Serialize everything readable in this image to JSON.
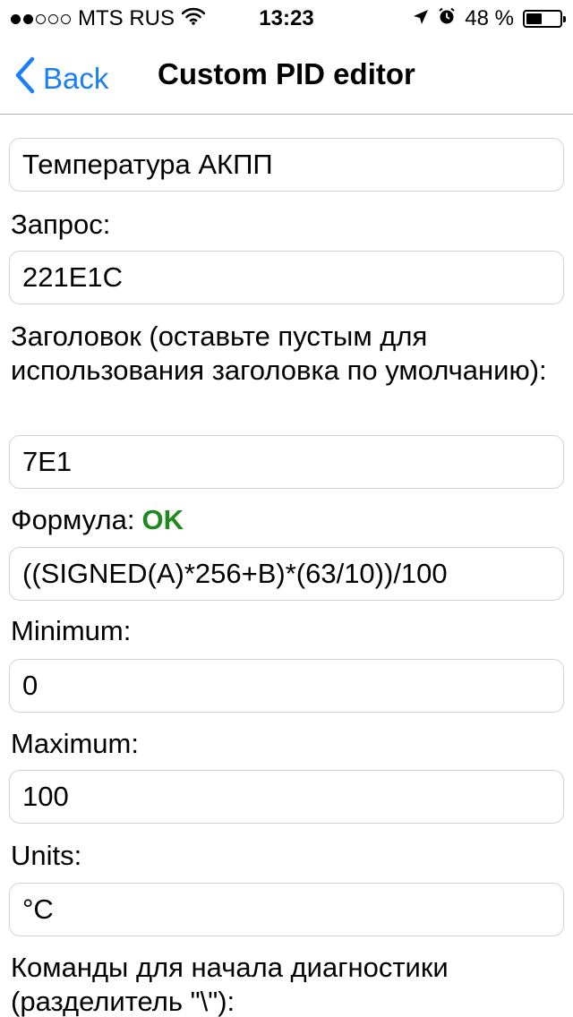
{
  "status_bar": {
    "carrier": "MTS RUS",
    "time": "13:23",
    "battery": "48 %",
    "battery_level": 0.48
  },
  "nav": {
    "back_label": "Back",
    "title": "Custom PID editor"
  },
  "form": {
    "name_value": "Температура АКПП",
    "request_label": "Запрос:",
    "request_value": "221E1C",
    "header_label": "Заголовок (оставьте пустым для использования заголовка по умолчанию):",
    "header_value": "7E1",
    "formula_label": "Формула:",
    "formula_status": "OK",
    "formula_value": "((SIGNED(A)*256+B)*(63/10))/100",
    "minimum_label": "Minimum:",
    "minimum_value": "0",
    "maximum_label": "Maximum:",
    "maximum_value": "100",
    "units_label": "Units:",
    "units_value": "°C",
    "diag_label": "Команды для начала диагностики (разделитель \"\\\"):"
  },
  "colors": {
    "accent": "#1a7ff6",
    "ok_green": "#1e8a1e",
    "field_border": "#d3d3d3"
  }
}
